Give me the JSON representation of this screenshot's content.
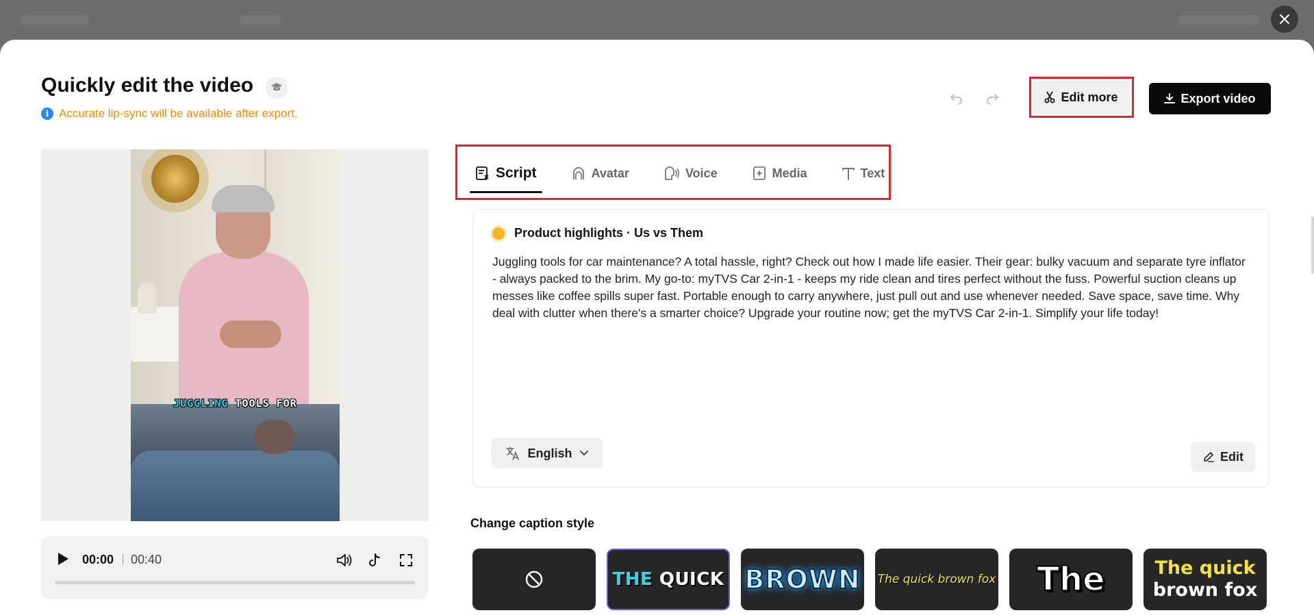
{
  "modal": {
    "title": "Quickly edit the video",
    "notice": "Accurate lip-sync will be available after export.",
    "edit_more_label": "Edit more",
    "export_label": "Export video"
  },
  "player": {
    "current_time": "00:00",
    "total_time": "00:40",
    "caption_highlight": "JUGGLING",
    "caption_rest": "TOOLS FOR",
    "progress": 0
  },
  "tabs": [
    {
      "label": "Script",
      "active": true
    },
    {
      "label": "Avatar",
      "active": false
    },
    {
      "label": "Voice",
      "active": false
    },
    {
      "label": "Media",
      "active": false
    },
    {
      "label": "Text",
      "active": false
    }
  ],
  "script": {
    "header": "Product highlights · Us vs Them",
    "body": "Juggling tools for car maintenance? A total hassle, right? Check out how I made life easier. Their gear: bulky vacuum and separate tyre inflator - always packed to the brim. My go-to: myTVS Car 2-in-1 - keeps my ride clean and tires perfect without the fuss. Powerful suction cleans up messes like coffee spills super fast. Portable enough to carry anywhere, just pull out and use whenever needed. Save space, save time. Why deal with clutter when there's a smarter choice? Upgrade your routine now; get the myTVS Car 2-in-1. Simplify your life today!",
    "language": "English",
    "edit_label": "Edit"
  },
  "captions": {
    "label": "Change caption style",
    "styles": {
      "quick_a": "THE",
      "quick_b": "QUICK",
      "brown": "BROWN",
      "fox": "The quick brown fox",
      "the": "The",
      "qbf_line1": "The quick",
      "qbf_line2": "brown fox"
    }
  },
  "colors": {
    "accent_red": "#e3222d",
    "notice_orange": "#f08a00",
    "selected_outline": "#6a5cf0"
  }
}
